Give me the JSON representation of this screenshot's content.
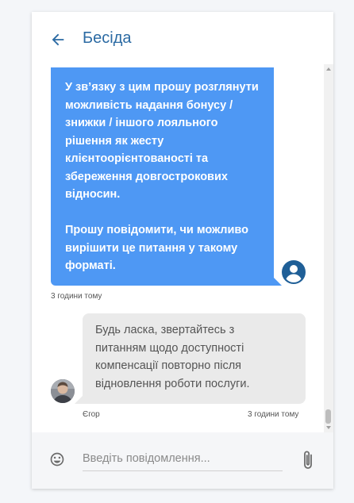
{
  "header": {
    "title": "Бесіда"
  },
  "messages": {
    "outgoing": {
      "text": "У зв’язку з цим прошу розглянути\nможливість надання бонусу /\nзнижки / іншого лояльного\nрішення як жесту\nклієнтоорієнтованості та\nзбереження довгострокових\nвідносин.\n\nПрошу повідомити, чи можливо\nвирішити це питання у такому\nформаті.",
      "time": "3 години тому"
    },
    "incoming": {
      "text": "Будь ласка, звертайтесь з\nпитанням щодо доступності\nкомпенсації повторно після\nвідновлення роботи послуги.",
      "sender": "Єгор",
      "time": "3 години тому"
    }
  },
  "composer": {
    "placeholder": "Введіть повідомлення..."
  },
  "colors": {
    "accent": "#2b6aa3",
    "outgoing_bubble": "#4e98f4",
    "incoming_bubble": "#eaeaea"
  },
  "icons": [
    "back-arrow-icon",
    "user-avatar-icon",
    "emoji-icon",
    "paperclip-icon"
  ]
}
